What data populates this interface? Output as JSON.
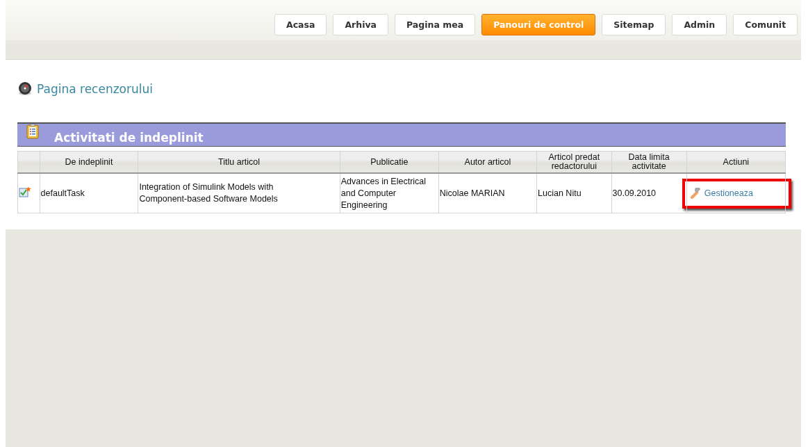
{
  "nav": {
    "tabs": [
      {
        "label": "Acasa",
        "selected": false
      },
      {
        "label": "Arhiva",
        "selected": false
      },
      {
        "label": "Pagina mea",
        "selected": false
      },
      {
        "label": "Panouri de control",
        "selected": true
      },
      {
        "label": "Sitemap",
        "selected": false
      },
      {
        "label": "Admin",
        "selected": false
      },
      {
        "label": "Comunit",
        "selected": false
      }
    ]
  },
  "page_title": "Pagina recenzorului",
  "section": {
    "title": "Activitati de indeplinit",
    "columns": [
      "De indeplinit",
      "Titlu articol",
      "Publicatie",
      "Autor articol",
      "Articol predat redactorului",
      "Data limita activitate",
      "Actiuni"
    ],
    "rows": [
      {
        "task": "defaultTask",
        "title": "Integration of Simulink Models with Component-based Software Models",
        "publication": "Advances in Electrical and Computer Engineering",
        "author": "Nicolae MARIAN",
        "editor": "Lucian Nitu",
        "deadline": "30.09.2010",
        "action": {
          "label": "Gestioneaza",
          "highlighted": true
        }
      }
    ]
  }
}
